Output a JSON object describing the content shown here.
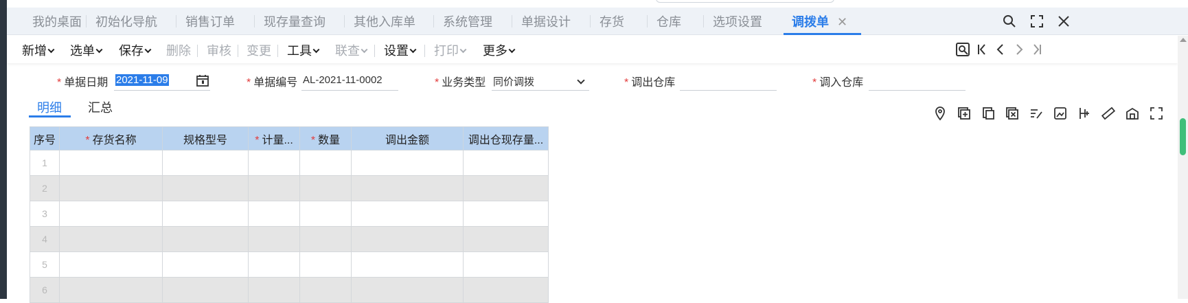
{
  "tabs": [
    {
      "label": "我的桌面"
    },
    {
      "label": "初始化导航"
    },
    {
      "label": "销售订单"
    },
    {
      "label": "现存量查询"
    },
    {
      "label": "其他入库单"
    },
    {
      "label": "系统管理"
    },
    {
      "label": "单据设计"
    },
    {
      "label": "存货"
    },
    {
      "label": "仓库"
    },
    {
      "label": "选项设置"
    },
    {
      "label": "调拨单",
      "active": true
    }
  ],
  "toolbar": {
    "items": [
      {
        "label": "新增",
        "dropdown": true,
        "enabled": true
      },
      {
        "label": "选单",
        "dropdown": true,
        "enabled": true
      },
      {
        "label": "保存",
        "dropdown": true,
        "enabled": true
      },
      {
        "label": "删除",
        "dropdown": false,
        "enabled": false
      },
      {
        "label": "审核",
        "dropdown": false,
        "enabled": false
      },
      {
        "label": "变更",
        "dropdown": false,
        "enabled": false
      },
      {
        "label": "工具",
        "dropdown": true,
        "enabled": true
      },
      {
        "label": "联查",
        "dropdown": true,
        "enabled": false
      },
      {
        "label": "设置",
        "dropdown": true,
        "enabled": true
      },
      {
        "label": "打印",
        "dropdown": true,
        "enabled": false
      },
      {
        "label": "更多",
        "dropdown": true,
        "enabled": true
      }
    ]
  },
  "form": {
    "doc_date_label": "单据日期",
    "doc_date_value": "2021-11-09",
    "doc_no_label": "单据编号",
    "doc_no_value": "AL-2021-11-0002",
    "biz_type_label": "业务类型",
    "biz_type_value": "同价调拨",
    "out_wh_label": "调出仓库",
    "out_wh_value": "",
    "in_wh_label": "调入仓库",
    "in_wh_value": ""
  },
  "subtabs": {
    "detail": "明细",
    "summary": "汇总"
  },
  "grid": {
    "columns": [
      {
        "label": "序号",
        "required": false
      },
      {
        "label": "存货名称",
        "required": true
      },
      {
        "label": "规格型号",
        "required": false
      },
      {
        "label": "计量...",
        "required": true
      },
      {
        "label": "数量",
        "required": true
      },
      {
        "label": "调出金额",
        "required": false
      },
      {
        "label": "调出仓现存量...",
        "required": false
      }
    ],
    "row_numbers": [
      "1",
      "2",
      "3",
      "4",
      "5",
      "6"
    ]
  },
  "colors": {
    "accent": "#2b7de9",
    "header_bg": "#b9d3f0",
    "required": "#e23c3c",
    "scroll_thumb": "#3fbf7a"
  }
}
